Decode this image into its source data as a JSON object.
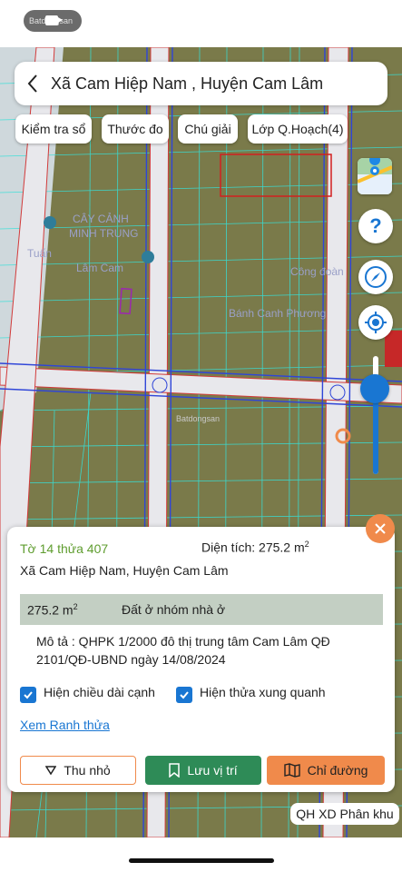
{
  "watermark": {
    "text": "Batdongsan"
  },
  "header": {
    "title": "Xã Cam Hiệp Nam , Huyện Cam Lâm"
  },
  "chips": [
    {
      "label": "Kiểm tra sổ"
    },
    {
      "label": "Thước đo"
    },
    {
      "label": "Chú giải"
    },
    {
      "label": "Lớp Q.Hoạch(4)"
    }
  ],
  "map": {
    "labels": {
      "place1": "CÂY CẢNH",
      "place2": "MINH TRUNG",
      "place3": "Tuấn",
      "place4": "Lâm Cam",
      "place5": "Công đoàn",
      "place6": "Bánh Canh Phương",
      "watermark_center": "Batdongsan"
    },
    "zoom_level": 0.7
  },
  "card": {
    "parcel_id": "Tờ 14 thửa 407",
    "area_label": "Diện tích: 275.2 m",
    "area_unit_sup": "2",
    "location": "Xã Cam Hiệp Nam, Huyện Cam Lâm",
    "band_area": "275.2 m",
    "band_area_sup": "2",
    "band_zone": "Đất ở nhóm nhà ở",
    "description": "Mô tả : QHPK 1/2000 đô thị trung tâm Cam Lâm QĐ 2101/QĐ-UBND ngày 14/08/2024",
    "checkbox1": "Hiện chiều dài cạnh",
    "checkbox2": "Hiện thửa xung quanh",
    "view_link": "Xem Ranh thửa",
    "btn_collapse": "Thu nhỏ",
    "btn_save": "Lưu vị trí",
    "btn_directions": "Chỉ đường"
  },
  "zone_label": "QH XD Phân khu",
  "colors": {
    "accent": "#1976d2",
    "orange": "#f08a4b",
    "green": "#2e8b57",
    "parcel_green": "#5f9d2f",
    "map_fill": "#7a7a4a"
  }
}
